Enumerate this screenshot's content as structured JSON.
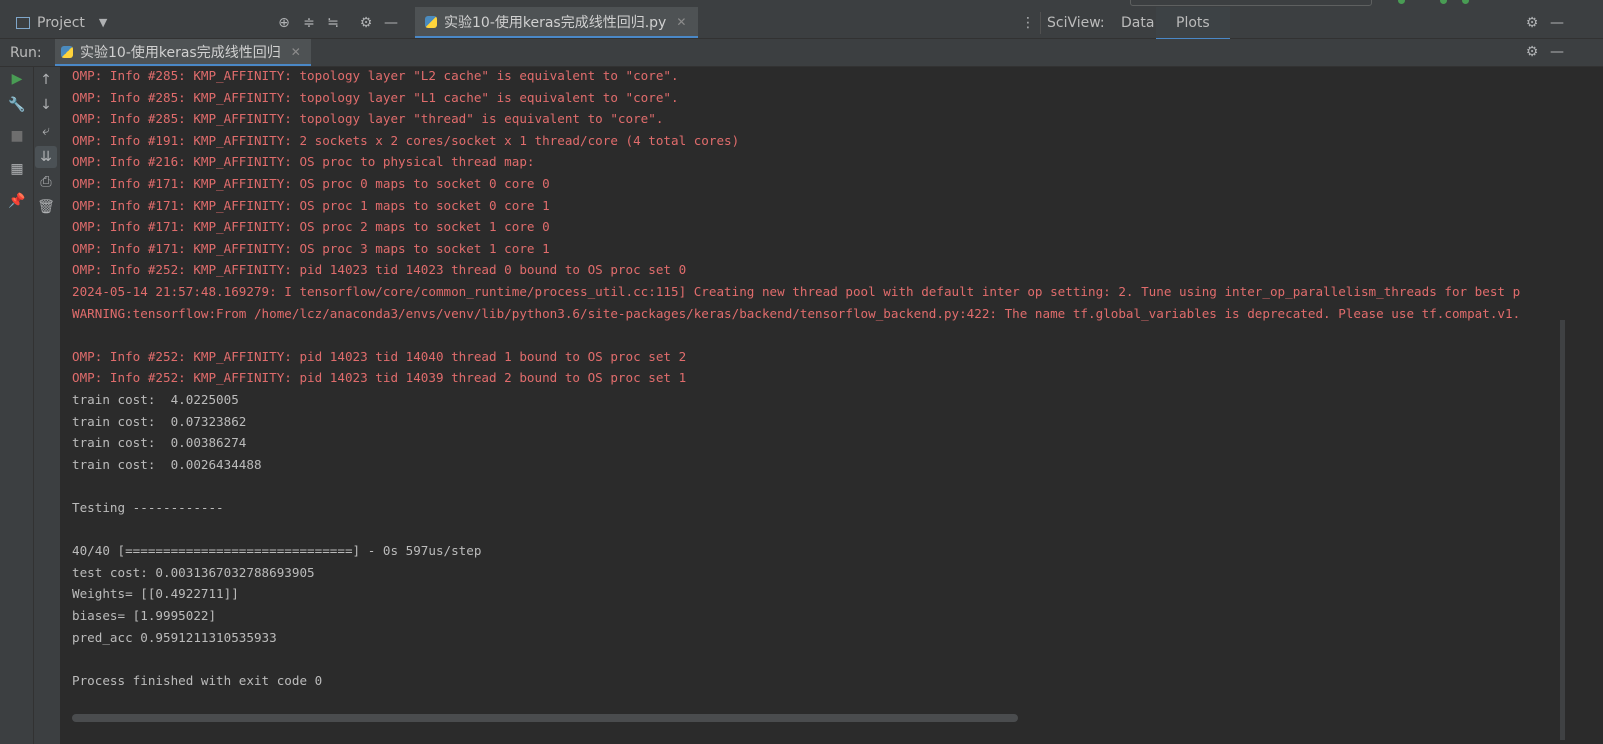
{
  "header": {
    "project_label": "Project",
    "editor_tab_label": "实验10-使用keras完成线性回归.py",
    "sciview_label": "SciView:",
    "sciview_tabs": [
      "Data",
      "Plots"
    ]
  },
  "runbar": {
    "run_label": "Run:",
    "run_tab_label": "实验10-使用keras完成线性回归"
  },
  "icons": {
    "project": "window-icon",
    "locate": "crosshair-icon",
    "collapse": "collapse-icon",
    "expand": "expand-icon",
    "settings": "gear-icon",
    "hide": "minimize-icon",
    "python": "python-icon",
    "more": "more-vertical-icon"
  },
  "colors": {
    "stderr": "#e06c6c",
    "stdout": "#bbbbbb",
    "accent": "#4a88c7",
    "run_green": "#499c54"
  },
  "console": {
    "lines": [
      {
        "text": "OMP: Info #285: KMP_AFFINITY: topology layer \"L2 cache\" is equivalent to \"core\".",
        "kind": "err"
      },
      {
        "text": "OMP: Info #285: KMP_AFFINITY: topology layer \"L1 cache\" is equivalent to \"core\".",
        "kind": "err"
      },
      {
        "text": "OMP: Info #285: KMP_AFFINITY: topology layer \"thread\" is equivalent to \"core\".",
        "kind": "err"
      },
      {
        "text": "OMP: Info #191: KMP_AFFINITY: 2 sockets x 2 cores/socket x 1 thread/core (4 total cores)",
        "kind": "err"
      },
      {
        "text": "OMP: Info #216: KMP_AFFINITY: OS proc to physical thread map:",
        "kind": "err"
      },
      {
        "text": "OMP: Info #171: KMP_AFFINITY: OS proc 0 maps to socket 0 core 0",
        "kind": "err"
      },
      {
        "text": "OMP: Info #171: KMP_AFFINITY: OS proc 1 maps to socket 0 core 1",
        "kind": "err"
      },
      {
        "text": "OMP: Info #171: KMP_AFFINITY: OS proc 2 maps to socket 1 core 0",
        "kind": "err"
      },
      {
        "text": "OMP: Info #171: KMP_AFFINITY: OS proc 3 maps to socket 1 core 1",
        "kind": "err"
      },
      {
        "text": "OMP: Info #252: KMP_AFFINITY: pid 14023 tid 14023 thread 0 bound to OS proc set 0",
        "kind": "err"
      },
      {
        "text": "2024-05-14 21:57:48.169279: I tensorflow/core/common_runtime/process_util.cc:115] Creating new thread pool with default inter op setting: 2. Tune using inter_op_parallelism_threads for best p",
        "kind": "err"
      },
      {
        "text": "WARNING:tensorflow:From /home/lcz/anaconda3/envs/venv/lib/python3.6/site-packages/keras/backend/tensorflow_backend.py:422: The name tf.global_variables is deprecated. Please use tf.compat.v1.",
        "kind": "err"
      },
      {
        "text": "",
        "kind": "err"
      },
      {
        "text": "OMP: Info #252: KMP_AFFINITY: pid 14023 tid 14040 thread 1 bound to OS proc set 2",
        "kind": "err"
      },
      {
        "text": "OMP: Info #252: KMP_AFFINITY: pid 14023 tid 14039 thread 2 bound to OS proc set 1",
        "kind": "err"
      },
      {
        "text": "train cost:  4.0225005",
        "kind": "out"
      },
      {
        "text": "train cost:  0.07323862",
        "kind": "out"
      },
      {
        "text": "train cost:  0.00386274",
        "kind": "out"
      },
      {
        "text": "train cost:  0.0026434488",
        "kind": "out"
      },
      {
        "text": "",
        "kind": "out"
      },
      {
        "text": "Testing ------------",
        "kind": "out"
      },
      {
        "text": "",
        "kind": "out"
      },
      {
        "text": "40/40 [==============================] - 0s 597us/step",
        "kind": "out"
      },
      {
        "text": "test cost: 0.0031367032788693905",
        "kind": "out"
      },
      {
        "text": "Weights= [[0.4922711]]",
        "kind": "out"
      },
      {
        "text": "biases= [1.9995022]",
        "kind": "out"
      },
      {
        "text": "pred_acc 0.9591211310535933",
        "kind": "out"
      },
      {
        "text": "",
        "kind": "out"
      },
      {
        "text": "Process finished with exit code 0",
        "kind": "out"
      }
    ]
  }
}
